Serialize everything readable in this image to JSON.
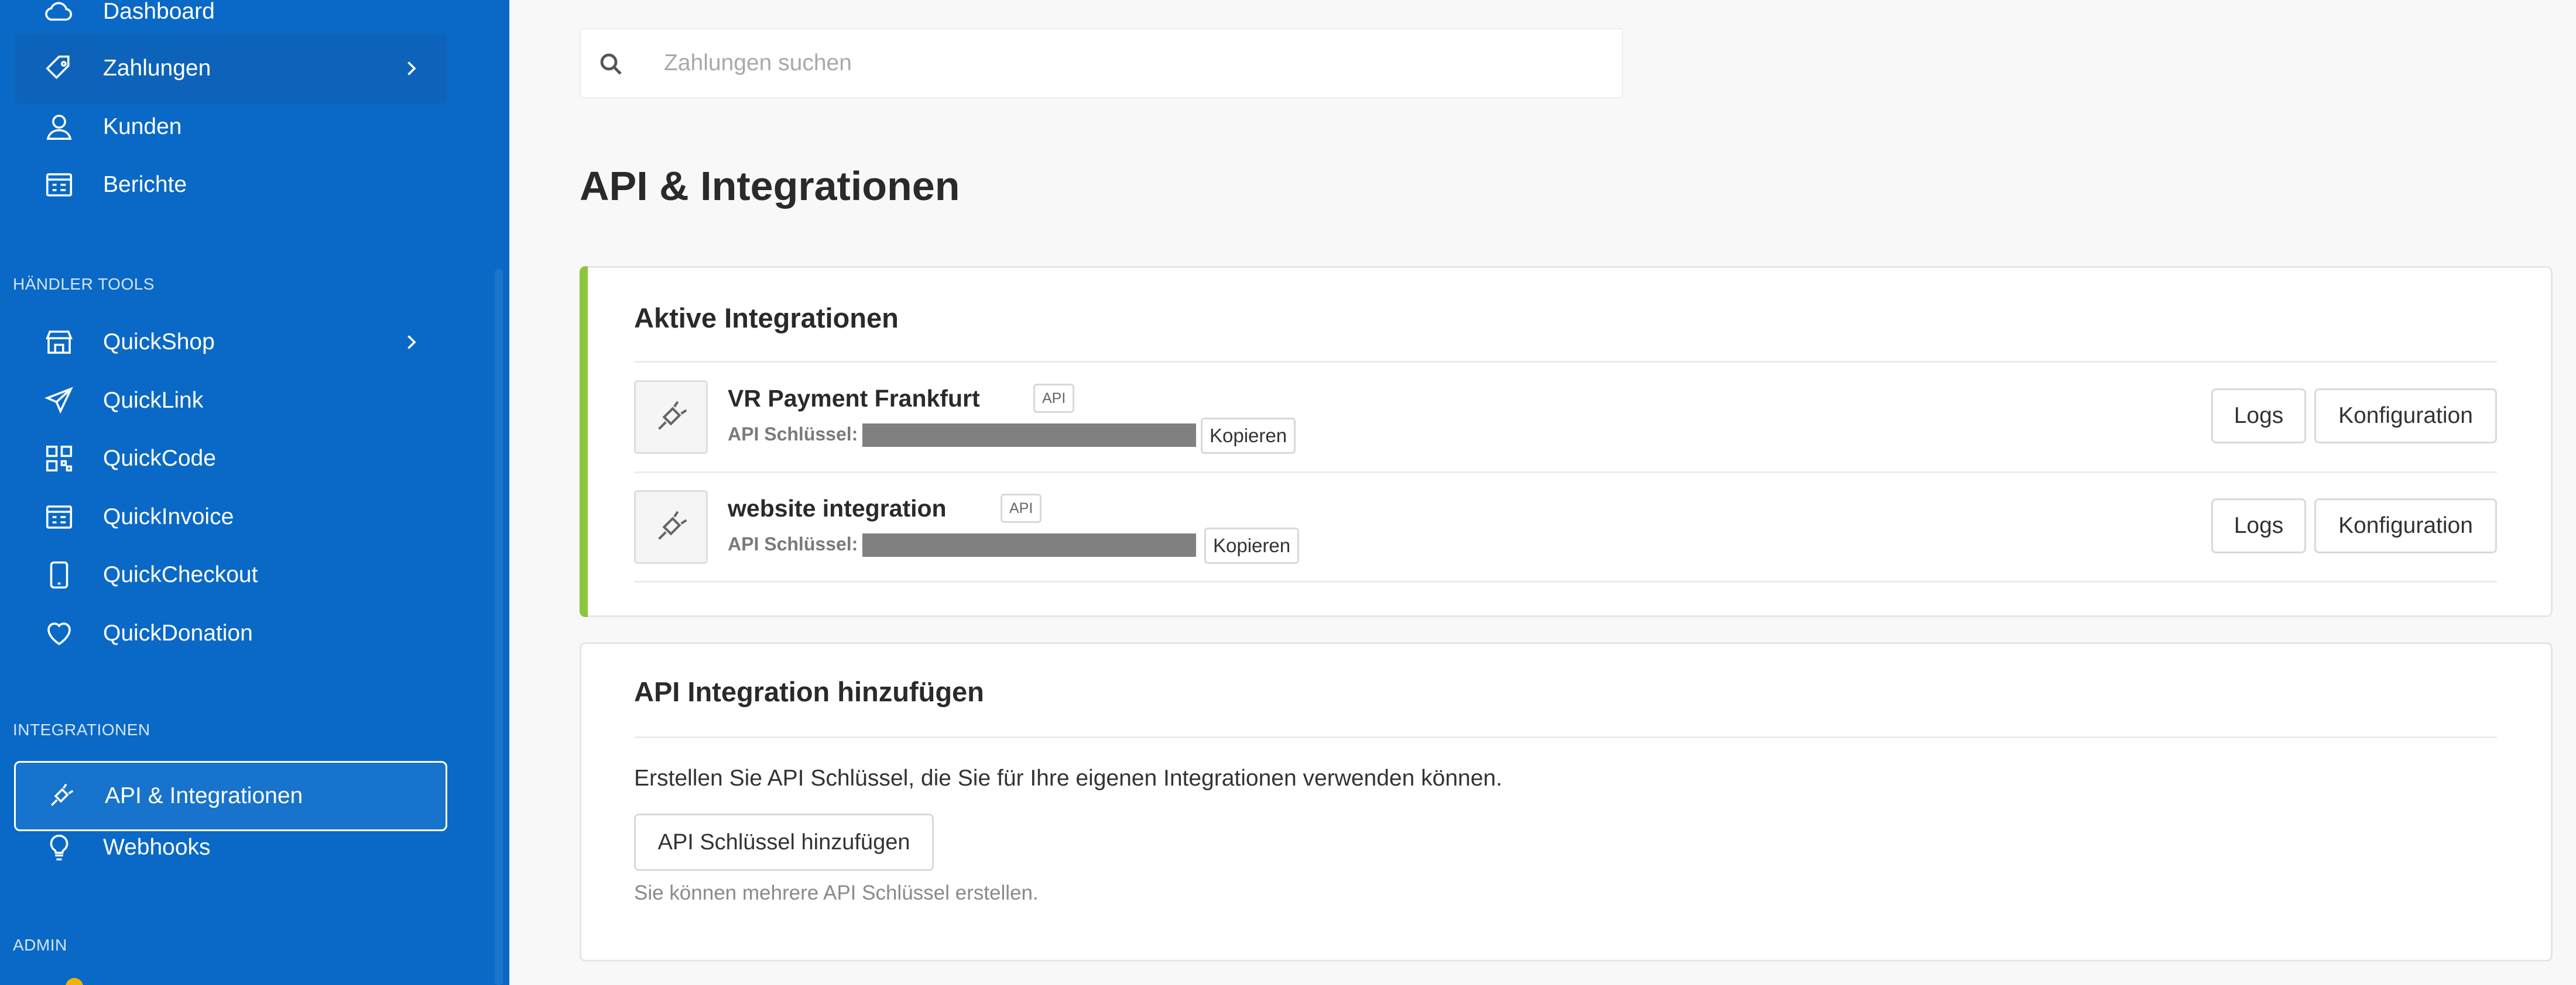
{
  "search": {
    "placeholder": "Zahlungen suchen"
  },
  "sidebar": {
    "items": [
      {
        "label": "Dashboard",
        "icon": "cloud-icon"
      },
      {
        "label": "Zahlungen",
        "icon": "tag-icon"
      },
      {
        "label": "Kunden",
        "icon": "user-icon"
      },
      {
        "label": "Berichte",
        "icon": "report-icon"
      }
    ],
    "tools_heading": "HÄNDLER TOOLS",
    "tools": [
      {
        "label": "QuickShop",
        "icon": "store-icon"
      },
      {
        "label": "QuickLink",
        "icon": "paper-plane-icon"
      },
      {
        "label": "QuickCode",
        "icon": "qr-code-icon"
      },
      {
        "label": "QuickInvoice",
        "icon": "invoice-icon"
      },
      {
        "label": "QuickCheckout",
        "icon": "mobile-icon"
      },
      {
        "label": "QuickDonation",
        "icon": "heart-icon"
      }
    ],
    "integrations_heading": "INTEGRATIONEN",
    "integrations": [
      {
        "label": "API & Integrationen",
        "icon": "plug-icon",
        "selected": true
      },
      {
        "label": "Webhooks",
        "icon": "lightbulb-icon"
      }
    ],
    "admin_heading": "ADMIN"
  },
  "page": {
    "title": "API & Integrationen"
  },
  "active_integrations": {
    "title": "Aktive Integrationen",
    "accent_color": "#8cc63f",
    "rows": [
      {
        "name": "VR Payment Frankfurt",
        "badge": "API",
        "key_label": "API Schlüssel:",
        "copy_label": "Kopieren",
        "logs_label": "Logs",
        "config_label": "Konfiguration"
      },
      {
        "name": "website integration",
        "badge": "API",
        "key_label": "API Schlüssel:",
        "copy_label": "Kopieren",
        "logs_label": "Logs",
        "config_label": "Konfiguration"
      }
    ]
  },
  "add_integration": {
    "title": "API Integration hinzufügen",
    "description": "Erstellen Sie API Schlüssel, die Sie für Ihre eigenen Integrationen verwenden können.",
    "button_label": "API Schlüssel hinzufügen",
    "hint": "Sie können mehrere API Schlüssel erstellen."
  },
  "colors": {
    "sidebar_bg": "#0a69c6",
    "accent": "#8cc63f"
  }
}
